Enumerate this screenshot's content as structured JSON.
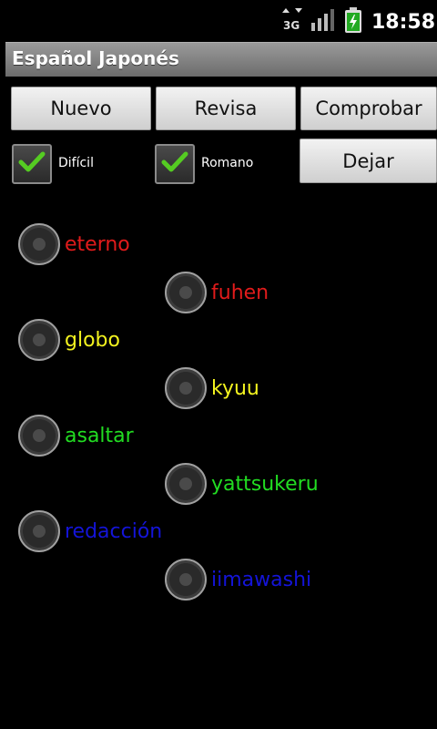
{
  "status": {
    "time": "18:58",
    "network": "3G"
  },
  "app": {
    "title": "Español Japonés"
  },
  "buttons": {
    "nuevo": "Nuevo",
    "revisa": "Revisa",
    "comprobar": "Comprobar",
    "dejar": "Dejar"
  },
  "options": {
    "dificil": {
      "label": "Difícil",
      "checked": true
    },
    "romano": {
      "label": "Romano",
      "checked": true
    }
  },
  "colors": {
    "red": "#e11b1b",
    "yellow": "#f3f31f",
    "green": "#22dd22",
    "blue": "#1414d8",
    "check_green": "#55cc22"
  },
  "words": [
    {
      "text": "eterno",
      "color": "red"
    },
    {
      "text": "fuhen",
      "color": "red"
    },
    {
      "text": "globo",
      "color": "yellow"
    },
    {
      "text": "kyuu",
      "color": "yellow"
    },
    {
      "text": "asaltar",
      "color": "green"
    },
    {
      "text": "yattsukeru",
      "color": "green"
    },
    {
      "text": "redacción",
      "color": "blue"
    },
    {
      "text": "iimawashi",
      "color": "blue"
    }
  ]
}
